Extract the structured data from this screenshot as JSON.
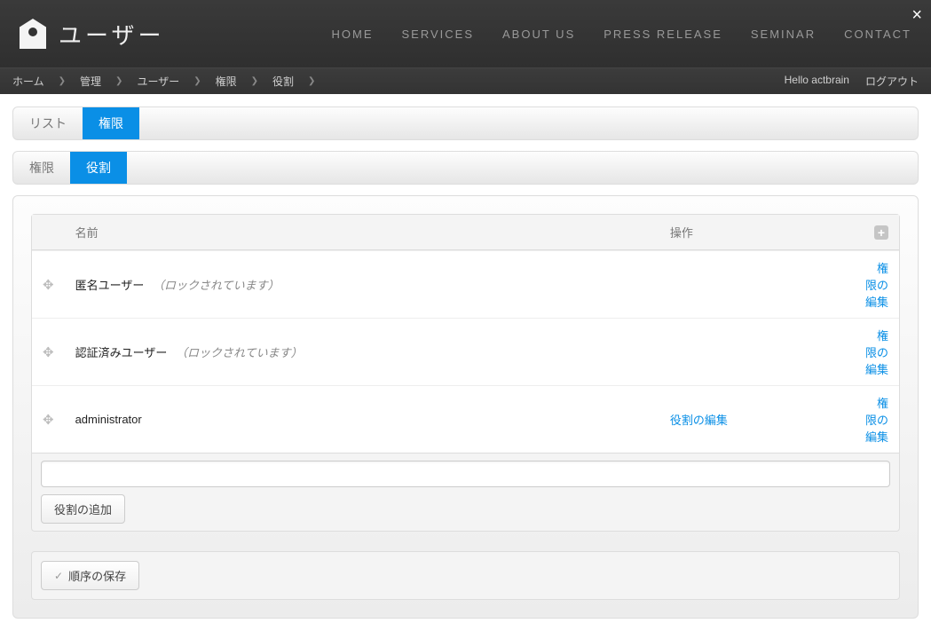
{
  "app": {
    "title": "ユーザー"
  },
  "close_label": "×",
  "nav": {
    "home": "HOME",
    "services": "SERVICES",
    "about": "ABOUT US",
    "press": "PRESS RELEASE",
    "seminar": "SEMINAR",
    "contact": "CONTACT"
  },
  "breadcrumb": {
    "sep": "❯",
    "items": [
      "ホーム",
      "管理",
      "ユーザー",
      "権限",
      "役割"
    ]
  },
  "userbar": {
    "greeting": "Hello actbrain",
    "logout": "ログアウト"
  },
  "tabs1": {
    "list": "リスト",
    "perm": "権限"
  },
  "tabs2": {
    "perm": "権限",
    "role": "役割"
  },
  "table": {
    "col_name": "名前",
    "col_actions": "操作",
    "plus": "+",
    "locked_suffix": "（ロックされています）",
    "edit_role": "役割の編集",
    "edit_perm": "権限の編集",
    "rows": [
      {
        "name": "匿名ユーザー",
        "locked": true,
        "can_edit_role": false
      },
      {
        "name": "認証済みユーザー",
        "locked": true,
        "can_edit_role": false
      },
      {
        "name": "administrator",
        "locked": false,
        "can_edit_role": true
      }
    ]
  },
  "add": {
    "button": "役割の追加",
    "placeholder": ""
  },
  "save": {
    "button": "順序の保存"
  }
}
